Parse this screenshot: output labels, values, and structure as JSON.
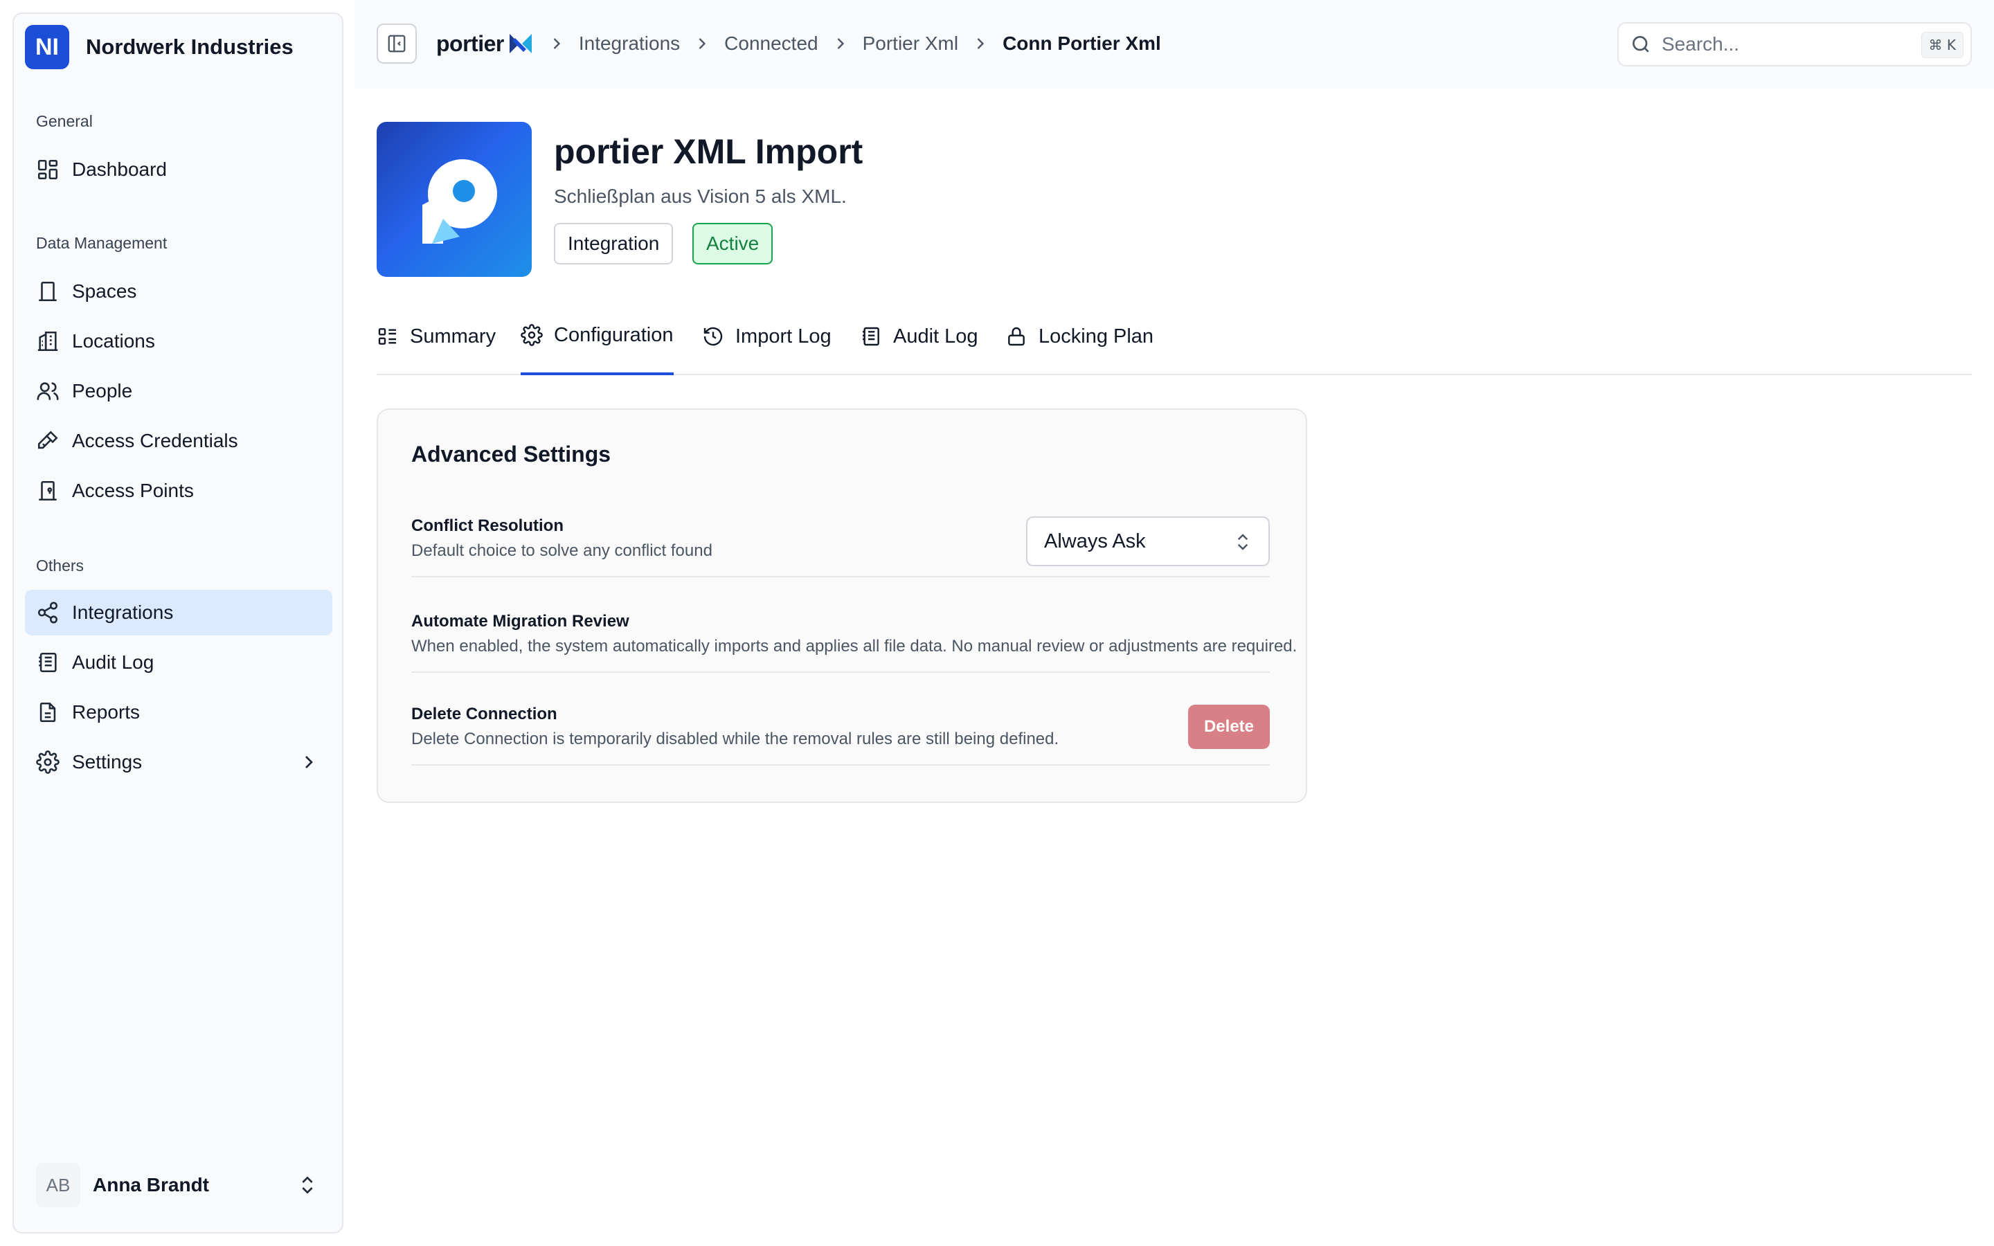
{
  "org": {
    "initials": "NI",
    "name": "Nordwerk Industries",
    "color": "#1d4ed8"
  },
  "sidebar": {
    "sections": [
      {
        "label": "General",
        "items": [
          {
            "label": "Dashboard",
            "icon": "dashboard-icon"
          }
        ]
      },
      {
        "label": "Data Management",
        "items": [
          {
            "label": "Spaces",
            "icon": "building-icon"
          },
          {
            "label": "Locations",
            "icon": "buildings-icon"
          },
          {
            "label": "People",
            "icon": "users-icon"
          },
          {
            "label": "Access Credentials",
            "icon": "key-icon"
          },
          {
            "label": "Access Points",
            "icon": "door-icon"
          }
        ]
      },
      {
        "label": "Others",
        "items": [
          {
            "label": "Integrations",
            "icon": "share-icon",
            "active": true
          },
          {
            "label": "Audit Log",
            "icon": "log-icon"
          },
          {
            "label": "Reports",
            "icon": "file-icon"
          },
          {
            "label": "Settings",
            "icon": "gear-icon"
          }
        ]
      }
    ],
    "user": {
      "initials": "AB",
      "name": "Anna Brandt"
    }
  },
  "topbar": {
    "brand": "portier",
    "breadcrumbs": [
      "Integrations",
      "Connected",
      "Portier Xml",
      "Conn Portier Xml"
    ],
    "search_placeholder": "Search...",
    "shortcut": "⌘ K"
  },
  "app": {
    "title": "portier XML Import",
    "subtitle": "Schließplan aus Vision 5 als XML.",
    "badges": [
      "Integration",
      "Active"
    ],
    "status_color": "#16a34a"
  },
  "tabs": [
    {
      "label": "Summary",
      "icon": "summary-icon"
    },
    {
      "label": "Configuration",
      "icon": "gear-icon",
      "active": true
    },
    {
      "label": "Import Log",
      "icon": "history-icon"
    },
    {
      "label": "Audit Log",
      "icon": "log-icon"
    },
    {
      "label": "Locking Plan",
      "icon": "lock-icon"
    }
  ],
  "settings": {
    "title": "Advanced Settings",
    "conflict": {
      "title": "Conflict Resolution",
      "desc": "Default choice to solve any conflict found",
      "value": "Always Ask"
    },
    "automate": {
      "title": "Automate Migration Review",
      "desc": "When enabled, the system automatically imports and applies all file data. No manual review or adjustments are required."
    },
    "delete": {
      "title": "Delete Connection",
      "desc": "Delete Connection is temporarily disabled while the removal rules are still being defined.",
      "button": "Delete"
    }
  }
}
